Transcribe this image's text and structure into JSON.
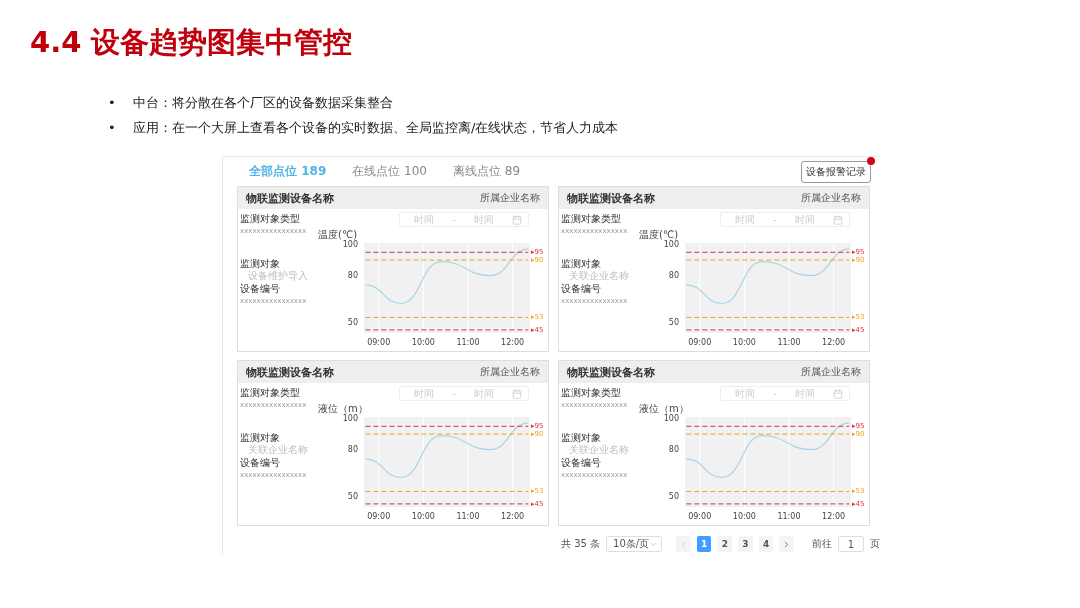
{
  "title": "4.4 设备趋势图集中管控",
  "bullets": [
    {
      "marker": "•",
      "text": "中台：将分散在各个厂区的设备数据采集整合"
    },
    {
      "marker": "•",
      "text": "应用：在一个大屏上查看各个设备的实时数据、全局监控离/在线状态，节省人力成本"
    }
  ],
  "dashboard": {
    "tabs": [
      {
        "label": "全部点位 189",
        "selected": true
      },
      {
        "label": "在线点位 100",
        "selected": false
      },
      {
        "label": "离线点位 89",
        "selected": false
      }
    ],
    "alarm_button": {
      "label": "设备报警记录",
      "badge": true
    },
    "cards": [
      {
        "name": "物联监测设备名称",
        "company": "所属企业名称",
        "type_label": "监测对象类型",
        "type_value": "xxxxxxxxxxxxxxxx",
        "object_label": "监测对象",
        "object_value": "设备维护导入",
        "code_label": "设备编号",
        "code_value": "xxxxxxxxxxxxxxxx",
        "date_start": "时间",
        "date_sep": "-",
        "date_end": "时间",
        "chart_data": {
          "type": "line",
          "ylabel": "温度(℃)",
          "x": [
            8.7,
            9.5,
            10.4,
            11.5,
            12.35
          ],
          "xlim": [
            8.67,
            12.39
          ],
          "ylim": [
            43,
            101
          ],
          "grid": true,
          "legend": "right",
          "xticks": [
            {
              "value": 9,
              "label": "09:00"
            },
            {
              "value": 10,
              "label": "10:00"
            },
            {
              "value": 11,
              "label": "11:00"
            },
            {
              "value": 12,
              "label": "12:00"
            }
          ],
          "yticks": [
            100,
            80,
            50
          ],
          "series": [
            {
              "color": "#a8d4ea",
              "line_style": "solid",
              "values": [
                74,
                62,
                89,
                80,
                97
              ]
            },
            {
              "name": "▸95",
              "color": "#d9333f",
              "line_style": "dashed",
              "values": [
                95,
                95,
                95,
                95,
                95
              ]
            },
            {
              "name": "▸90",
              "color": "#f0a020",
              "line_style": "dashed",
              "values": [
                90,
                90,
                90,
                90,
                90
              ]
            },
            {
              "name": "▸53",
              "color": "#f0a020",
              "line_style": "dashed",
              "values": [
                53,
                53,
                53,
                53,
                53
              ]
            },
            {
              "name": "▸45",
              "color": "#d9333f",
              "line_style": "dashed",
              "values": [
                45,
                45,
                45,
                45,
                45
              ]
            }
          ]
        }
      },
      {
        "name": "物联监测设备名称",
        "company": "所属企业名称",
        "type_label": "监测对象类型",
        "type_value": "xxxxxxxxxxxxxxxx",
        "object_label": "监测对象",
        "object_value": "关联企业名称",
        "code_label": "设备编号",
        "code_value": "xxxxxxxxxxxxxxxx",
        "date_start": "时间",
        "date_sep": "-",
        "date_end": "时间",
        "chart_data": {
          "type": "line",
          "ylabel": "温度(℃)",
          "x": [
            8.7,
            9.5,
            10.4,
            11.5,
            12.35
          ],
          "xlim": [
            8.67,
            12.39
          ],
          "ylim": [
            43,
            101
          ],
          "grid": true,
          "legend": "right",
          "xticks": [
            {
              "value": 9,
              "label": "09:00"
            },
            {
              "value": 10,
              "label": "10:00"
            },
            {
              "value": 11,
              "label": "11:00"
            },
            {
              "value": 12,
              "label": "12:00"
            }
          ],
          "yticks": [
            100,
            80,
            50
          ],
          "series": [
            {
              "color": "#a8d4ea",
              "line_style": "solid",
              "values": [
                74,
                62,
                89,
                80,
                97
              ]
            },
            {
              "name": "▸95",
              "color": "#d9333f",
              "line_style": "dashed",
              "values": [
                95,
                95,
                95,
                95,
                95
              ]
            },
            {
              "name": "▸90",
              "color": "#f0a020",
              "line_style": "dashed",
              "values": [
                90,
                90,
                90,
                90,
                90
              ]
            },
            {
              "name": "▸53",
              "color": "#f0a020",
              "line_style": "dashed",
              "values": [
                53,
                53,
                53,
                53,
                53
              ]
            },
            {
              "name": "▸45",
              "color": "#d9333f",
              "line_style": "dashed",
              "values": [
                45,
                45,
                45,
                45,
                45
              ]
            }
          ]
        }
      },
      {
        "name": "物联监测设备名称",
        "company": "所属企业名称",
        "type_label": "监测对象类型",
        "type_value": "xxxxxxxxxxxxxxxx",
        "object_label": "监测对象",
        "object_value": "关联企业名称",
        "code_label": "设备编号",
        "code_value": "xxxxxxxxxxxxxxxx",
        "date_start": "时间",
        "date_sep": "-",
        "date_end": "时间",
        "chart_data": {
          "type": "line",
          "ylabel": "液位（m）",
          "x": [
            8.7,
            9.5,
            10.4,
            11.5,
            12.35
          ],
          "xlim": [
            8.67,
            12.39
          ],
          "ylim": [
            43,
            101
          ],
          "grid": true,
          "legend": "right",
          "xticks": [
            {
              "value": 9,
              "label": "09:00"
            },
            {
              "value": 10,
              "label": "10:00"
            },
            {
              "value": 11,
              "label": "11:00"
            },
            {
              "value": 12,
              "label": "12:00"
            }
          ],
          "yticks": [
            100,
            80,
            50
          ],
          "series": [
            {
              "color": "#a8d4ea",
              "line_style": "solid",
              "values": [
                74,
                62,
                89,
                80,
                97
              ]
            },
            {
              "name": "▸95",
              "color": "#d9333f",
              "line_style": "dashed",
              "values": [
                95,
                95,
                95,
                95,
                95
              ]
            },
            {
              "name": "▸90",
              "color": "#f0a020",
              "line_style": "dashed",
              "values": [
                90,
                90,
                90,
                90,
                90
              ]
            },
            {
              "name": "▸53",
              "color": "#f0a020",
              "line_style": "dashed",
              "values": [
                53,
                53,
                53,
                53,
                53
              ]
            },
            {
              "name": "▸45",
              "color": "#d9333f",
              "line_style": "dashed",
              "values": [
                45,
                45,
                45,
                45,
                45
              ]
            }
          ]
        }
      },
      {
        "name": "物联监测设备名称",
        "company": "所属企业名称",
        "type_label": "监测对象类型",
        "type_value": "xxxxxxxxxxxxxxxx",
        "object_label": "监测对象",
        "object_value": "关联企业名称",
        "code_label": "设备编号",
        "code_value": "xxxxxxxxxxxxxxxx",
        "date_start": "时间",
        "date_sep": "-",
        "date_end": "时间",
        "chart_data": {
          "type": "line",
          "ylabel": "液位（m）",
          "x": [
            8.7,
            9.5,
            10.4,
            11.5,
            12.35
          ],
          "xlim": [
            8.67,
            12.39
          ],
          "ylim": [
            43,
            101
          ],
          "grid": true,
          "legend": "right",
          "xticks": [
            {
              "value": 9,
              "label": "09:00"
            },
            {
              "value": 10,
              "label": "10:00"
            },
            {
              "value": 11,
              "label": "11:00"
            },
            {
              "value": 12,
              "label": "12:00"
            }
          ],
          "yticks": [
            100,
            80,
            50
          ],
          "series": [
            {
              "color": "#a8d4ea",
              "line_style": "solid",
              "values": [
                74,
                62,
                89,
                80,
                97
              ]
            },
            {
              "name": "▸95",
              "color": "#d9333f",
              "line_style": "dashed",
              "values": [
                95,
                95,
                95,
                95,
                95
              ]
            },
            {
              "name": "▸90",
              "color": "#f0a020",
              "line_style": "dashed",
              "values": [
                90,
                90,
                90,
                90,
                90
              ]
            },
            {
              "name": "▸53",
              "color": "#f0a020",
              "line_style": "dashed",
              "values": [
                53,
                53,
                53,
                53,
                53
              ]
            },
            {
              "name": "▸45",
              "color": "#d9333f",
              "line_style": "dashed",
              "values": [
                45,
                45,
                45,
                45,
                45
              ]
            }
          ]
        }
      }
    ],
    "pagination": {
      "total": "共 35 条",
      "page_size": "10条/页",
      "pages": [
        {
          "label": "1",
          "selected": true
        },
        {
          "label": "2",
          "selected": false
        },
        {
          "label": "3",
          "selected": false
        },
        {
          "label": "4",
          "selected": false
        }
      ],
      "goto_label": "前往",
      "goto_value": "1",
      "goto_suffix": "页"
    }
  }
}
